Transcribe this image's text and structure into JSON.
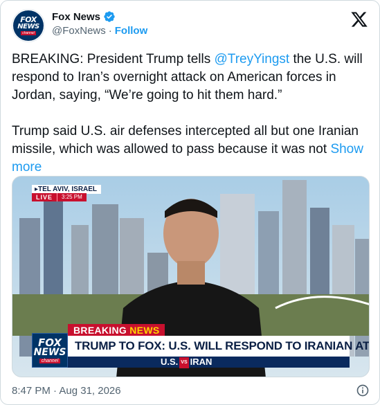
{
  "author": {
    "display_name": "Fox News",
    "handle": "@FoxNews",
    "separator": "·",
    "follow_label": "Follow",
    "avatar_lines": [
      "FOX",
      "NEWS",
      "channel"
    ]
  },
  "tweet": {
    "para1_prefix": "BREAKING: President Trump tells ",
    "mention": "@TreyYingst",
    "para1_suffix": " the U.S. will respond to Iran’s overnight attack on American forces in Jordan, saying, “We’re going to hit them hard.”",
    "para2": "Trump said U.S. air defenses intercepted all but one Iranian missile, which was allowed to pass because it was not ",
    "show_more": "Show more"
  },
  "media": {
    "location": "▸TEL AVIV, ISRAEL",
    "live_label": "LIVE",
    "live_time": "3:25 PM",
    "breaking_prefix": "BREAKING ",
    "breaking_suffix": "NEWS",
    "headline": "TRUMP TO FOX: U.S. WILL RESPOND TO IRANIAN ATTACKS",
    "ticker_left": "U.S.",
    "ticker_vs": "VS",
    "ticker_right": "IRAN",
    "bug_lines": [
      "FOX",
      "NEWS",
      "channel"
    ]
  },
  "footer": {
    "timestamp": "8:47 PM · Aug 31, 2026"
  },
  "colors": {
    "accent": "#1d9bf0",
    "fox_red": "#c8102e",
    "fox_blue": "#003366"
  },
  "icons": {
    "verified": "verified-badge-icon",
    "x": "x-logo-icon",
    "info": "info-icon"
  }
}
